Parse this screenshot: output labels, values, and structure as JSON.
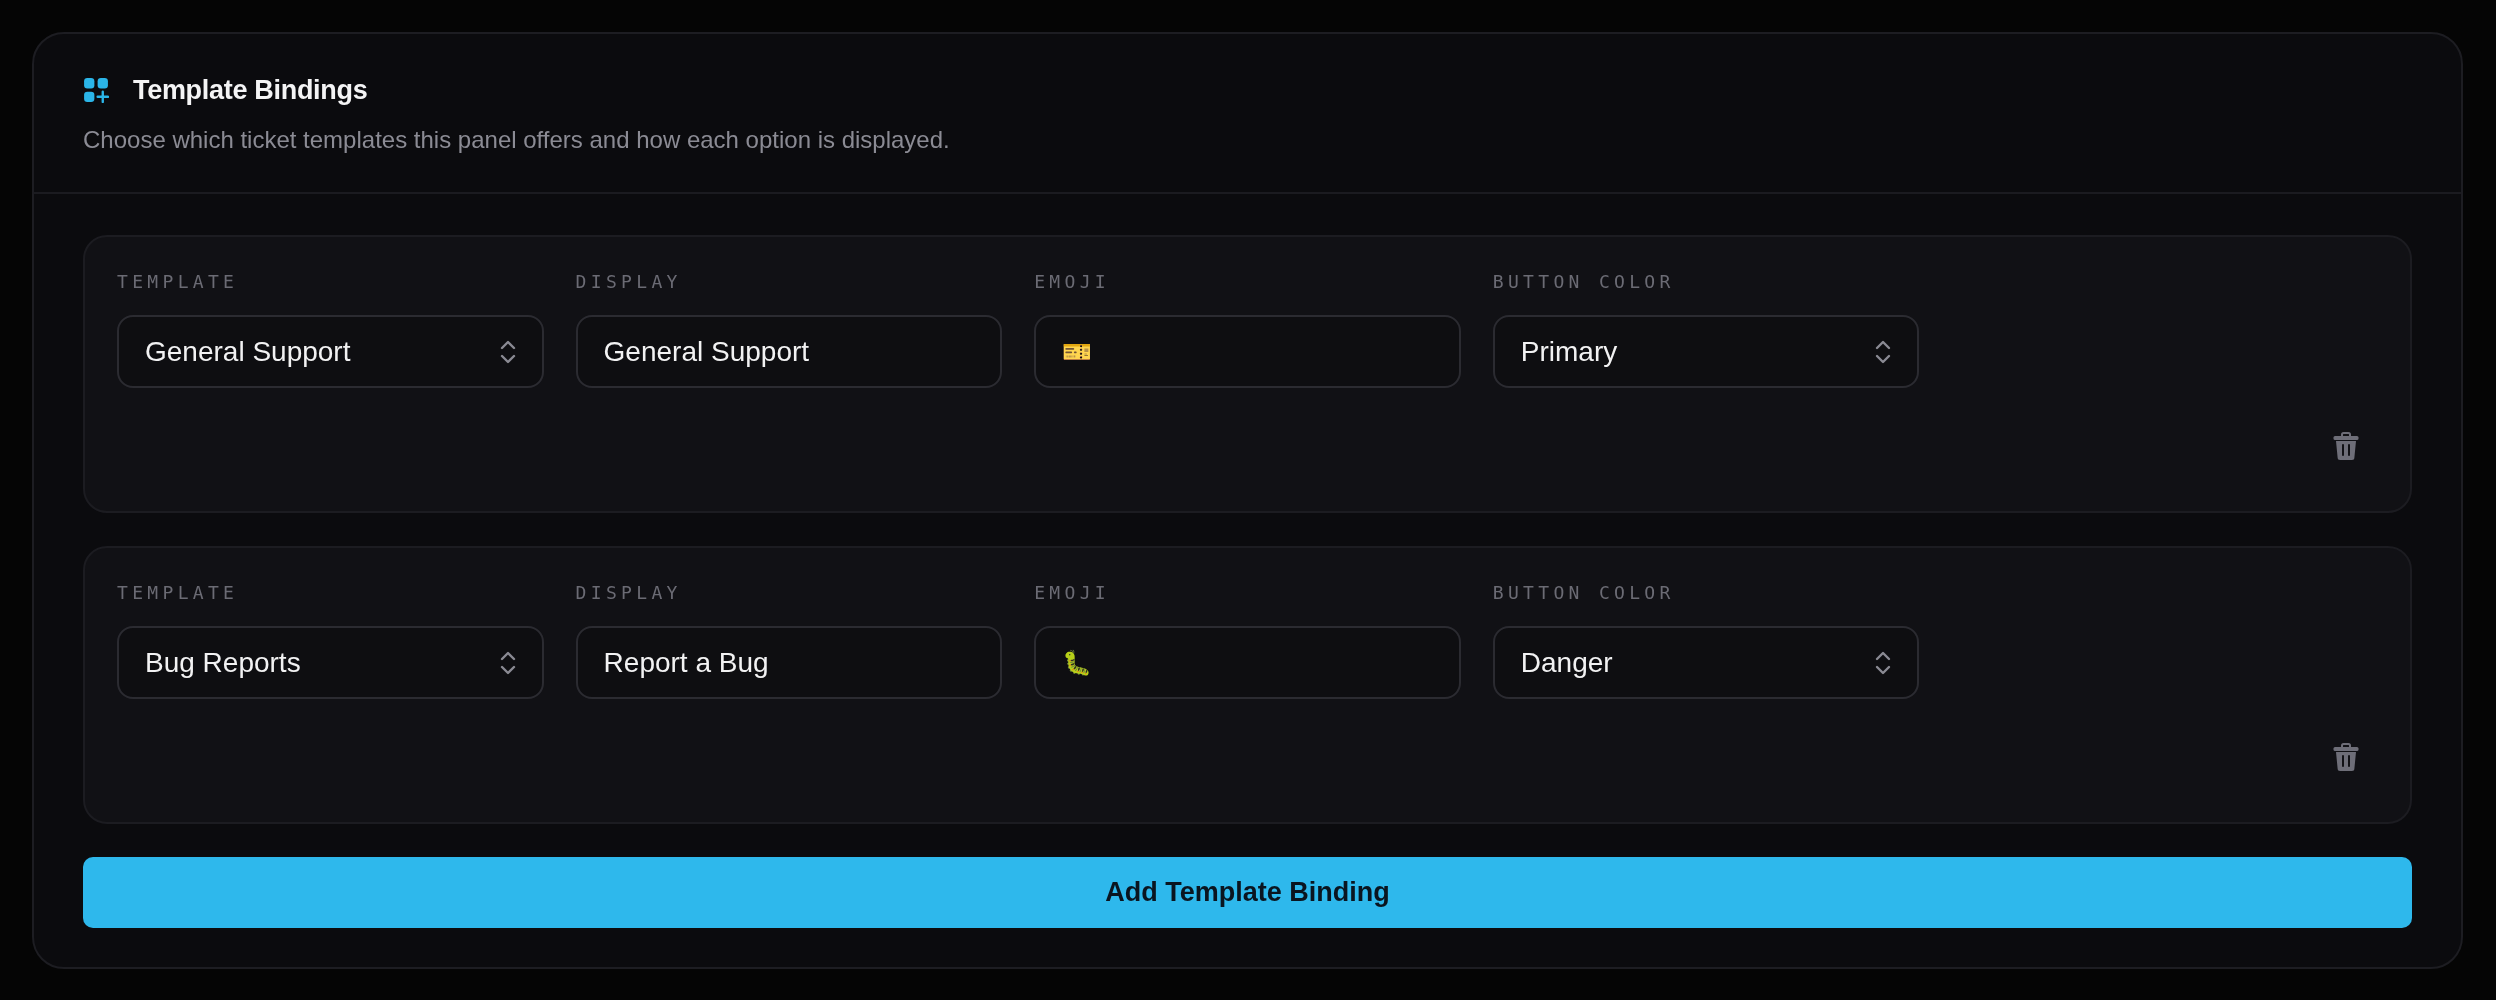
{
  "panel": {
    "title": "Template Bindings",
    "description": "Choose which ticket templates this panel offers and how each option is displayed."
  },
  "bindings": [
    {
      "fields": [
        {
          "label": "TEMPLATE",
          "kind": "select",
          "value": "General Support"
        },
        {
          "label": "DISPLAY",
          "kind": "text",
          "value": "General Support"
        },
        {
          "label": "EMOJI",
          "kind": "emoji",
          "value": "🎫"
        },
        {
          "label": "BUTTON COLOR",
          "kind": "select",
          "value": "Primary"
        }
      ]
    },
    {
      "fields": [
        {
          "label": "TEMPLATE",
          "kind": "select",
          "value": "Bug Reports"
        },
        {
          "label": "DISPLAY",
          "kind": "text",
          "value": "Report a Bug"
        },
        {
          "label": "EMOJI",
          "kind": "emoji",
          "value": "🐛"
        },
        {
          "label": "BUTTON COLOR",
          "kind": "select",
          "value": "Danger"
        }
      ]
    }
  ],
  "add_button": {
    "label": "Add Template Binding"
  }
}
